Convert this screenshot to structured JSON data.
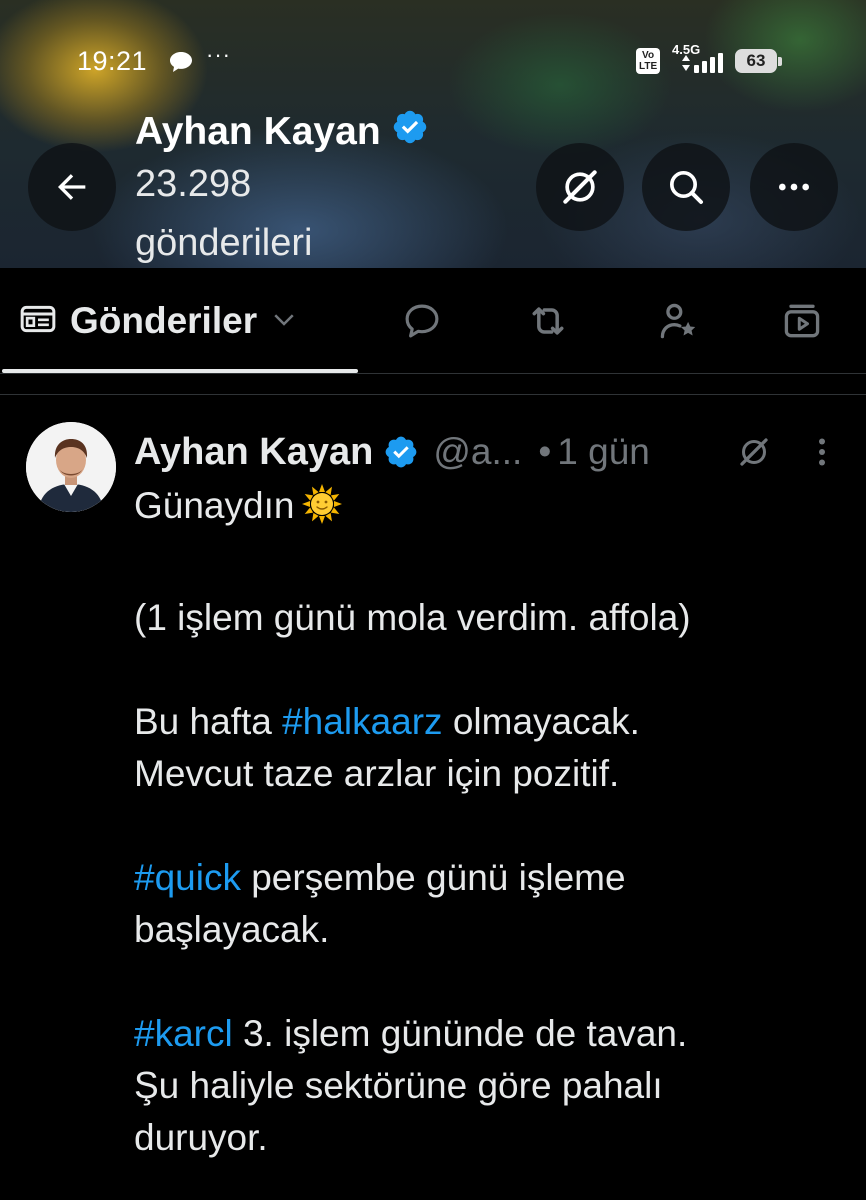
{
  "status_bar": {
    "time": "19:21",
    "overflow": "···",
    "volte": "Vo LTE",
    "network": "4.5G",
    "battery": "63"
  },
  "header": {
    "name": "Ayhan Kayan",
    "post_count": "23.298",
    "post_count_label": "gönderileri"
  },
  "tabs": {
    "posts_label": "Gönderiler",
    "icons": [
      "replies-icon",
      "reposts-icon",
      "spaces-icon",
      "media-icon"
    ]
  },
  "tweet": {
    "author_name": "Ayhan Kayan",
    "handle": "@a...",
    "separator": "•",
    "time": "1 gün",
    "lines": [
      {
        "segments": [
          {
            "text": "Günaydın"
          }
        ],
        "emoji": "sun"
      },
      {
        "blank": true
      },
      {
        "segments": [
          {
            "text": "(1 işlem günü mola verdim. affola)"
          }
        ]
      },
      {
        "blank": true
      },
      {
        "segments": [
          {
            "text": "Bu hafta "
          },
          {
            "text": "#halkaarz",
            "hashtag": true
          },
          {
            "text": " olmayacak."
          }
        ]
      },
      {
        "segments": [
          {
            "text": "Mevcut taze arzlar için pozitif."
          }
        ]
      },
      {
        "blank": true
      },
      {
        "segments": [
          {
            "text": "#quick",
            "hashtag": true
          },
          {
            "text": " perşembe günü işleme"
          }
        ]
      },
      {
        "segments": [
          {
            "text": "başlayacak."
          }
        ]
      },
      {
        "blank": true
      },
      {
        "segments": [
          {
            "text": "#karcl",
            "hashtag": true
          },
          {
            "text": " 3. işlem gününde de tavan."
          }
        ]
      },
      {
        "segments": [
          {
            "text": "Şu haliyle sektörüne göre pahalı"
          }
        ]
      },
      {
        "segments": [
          {
            "text": "duruyor."
          }
        ]
      }
    ]
  },
  "colors": {
    "background": "#000000",
    "text": "#e7e9ea",
    "secondary_text": "#71767b",
    "accent": "#1d9bf0",
    "verified": "#1d9bf0"
  }
}
